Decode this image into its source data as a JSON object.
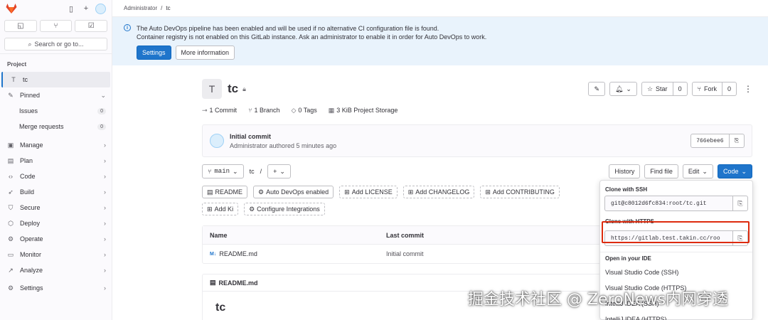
{
  "breadcrumb": {
    "parent": "Administrator",
    "sep": "/",
    "current": "tc"
  },
  "sidebar": {
    "search": "Search or go to...",
    "section": "Project",
    "project_item": "tc",
    "project_letter": "T",
    "pinned": "Pinned",
    "pinned_items": [
      {
        "label": "Issues",
        "count": "0"
      },
      {
        "label": "Merge requests",
        "count": "0"
      }
    ],
    "nav": [
      "Manage",
      "Plan",
      "Code",
      "Build",
      "Secure",
      "Deploy",
      "Operate",
      "Monitor",
      "Analyze"
    ],
    "settings": "Settings"
  },
  "alert": {
    "line1": "The Auto DevOps pipeline has been enabled and will be used if no alternative CI configuration file is found.",
    "line2": "Container registry is not enabled on this GitLab instance. Ask an administrator to enable it in order for Auto DevOps to work.",
    "settings_btn": "Settings",
    "more_btn": "More information"
  },
  "project": {
    "letter": "T",
    "name": "tc",
    "star": "Star",
    "star_count": "0",
    "fork": "Fork",
    "fork_count": "0",
    "stats": [
      "1 Commit",
      "1 Branch",
      "0 Tags",
      "3 KiB Project Storage"
    ]
  },
  "commit": {
    "title": "Initial commit",
    "meta": "Administrator authored 5 minutes ago",
    "sha": "766ebee6"
  },
  "toolbar": {
    "branch": "main",
    "path": "tc",
    "path_sep": "/",
    "history": "History",
    "find_file": "Find file",
    "edit": "Edit",
    "code": "Code"
  },
  "shortcuts": [
    "README",
    "Auto DevOps enabled",
    "Add LICENSE",
    "Add CHANGELOG",
    "Add CONTRIBUTING",
    "Add Ki",
    "Configure Integrations"
  ],
  "files": {
    "headers": [
      "Name",
      "Last commit"
    ],
    "rows": [
      {
        "name": "README.md",
        "commit": "Initial commit"
      }
    ]
  },
  "readme": {
    "filename": "README.md",
    "heading": "tc"
  },
  "clone": {
    "ssh_label": "Clone with SSH",
    "ssh_url": "git@c8012d6fc834:root/tc.git",
    "https_label": "Clone with HTTPS",
    "https_url": "https://gitlab.test.takin.cc/roo",
    "ide_label": "Open in your IDE",
    "ide_items": [
      "Visual Studio Code (SSH)",
      "Visual Studio Code (HTTPS)",
      "IntelliJ IDEA (SSH)",
      "IntelliJ IDEA (HTTPS)"
    ]
  },
  "watermark": "掘金技术社区 @ ZeroNews内网穿透",
  "colors": {
    "accent": "#1f75cb",
    "highlight": "#dd2b0e",
    "alert_bg": "#e9f3fc"
  }
}
